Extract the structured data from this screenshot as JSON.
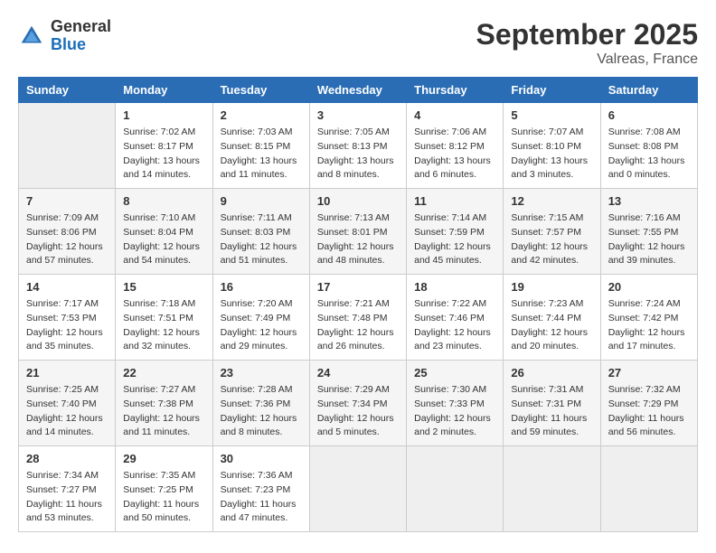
{
  "header": {
    "logo_general": "General",
    "logo_blue": "Blue",
    "month": "September 2025",
    "location": "Valreas, France"
  },
  "days_of_week": [
    "Sunday",
    "Monday",
    "Tuesday",
    "Wednesday",
    "Thursday",
    "Friday",
    "Saturday"
  ],
  "weeks": [
    [
      {
        "day": "",
        "sunrise": "",
        "sunset": "",
        "daylight": "",
        "empty": true
      },
      {
        "day": "1",
        "sunrise": "Sunrise: 7:02 AM",
        "sunset": "Sunset: 8:17 PM",
        "daylight": "Daylight: 13 hours and 14 minutes."
      },
      {
        "day": "2",
        "sunrise": "Sunrise: 7:03 AM",
        "sunset": "Sunset: 8:15 PM",
        "daylight": "Daylight: 13 hours and 11 minutes."
      },
      {
        "day": "3",
        "sunrise": "Sunrise: 7:05 AM",
        "sunset": "Sunset: 8:13 PM",
        "daylight": "Daylight: 13 hours and 8 minutes."
      },
      {
        "day": "4",
        "sunrise": "Sunrise: 7:06 AM",
        "sunset": "Sunset: 8:12 PM",
        "daylight": "Daylight: 13 hours and 6 minutes."
      },
      {
        "day": "5",
        "sunrise": "Sunrise: 7:07 AM",
        "sunset": "Sunset: 8:10 PM",
        "daylight": "Daylight: 13 hours and 3 minutes."
      },
      {
        "day": "6",
        "sunrise": "Sunrise: 7:08 AM",
        "sunset": "Sunset: 8:08 PM",
        "daylight": "Daylight: 13 hours and 0 minutes."
      }
    ],
    [
      {
        "day": "7",
        "sunrise": "Sunrise: 7:09 AM",
        "sunset": "Sunset: 8:06 PM",
        "daylight": "Daylight: 12 hours and 57 minutes."
      },
      {
        "day": "8",
        "sunrise": "Sunrise: 7:10 AM",
        "sunset": "Sunset: 8:04 PM",
        "daylight": "Daylight: 12 hours and 54 minutes."
      },
      {
        "day": "9",
        "sunrise": "Sunrise: 7:11 AM",
        "sunset": "Sunset: 8:03 PM",
        "daylight": "Daylight: 12 hours and 51 minutes."
      },
      {
        "day": "10",
        "sunrise": "Sunrise: 7:13 AM",
        "sunset": "Sunset: 8:01 PM",
        "daylight": "Daylight: 12 hours and 48 minutes."
      },
      {
        "day": "11",
        "sunrise": "Sunrise: 7:14 AM",
        "sunset": "Sunset: 7:59 PM",
        "daylight": "Daylight: 12 hours and 45 minutes."
      },
      {
        "day": "12",
        "sunrise": "Sunrise: 7:15 AM",
        "sunset": "Sunset: 7:57 PM",
        "daylight": "Daylight: 12 hours and 42 minutes."
      },
      {
        "day": "13",
        "sunrise": "Sunrise: 7:16 AM",
        "sunset": "Sunset: 7:55 PM",
        "daylight": "Daylight: 12 hours and 39 minutes."
      }
    ],
    [
      {
        "day": "14",
        "sunrise": "Sunrise: 7:17 AM",
        "sunset": "Sunset: 7:53 PM",
        "daylight": "Daylight: 12 hours and 35 minutes."
      },
      {
        "day": "15",
        "sunrise": "Sunrise: 7:18 AM",
        "sunset": "Sunset: 7:51 PM",
        "daylight": "Daylight: 12 hours and 32 minutes."
      },
      {
        "day": "16",
        "sunrise": "Sunrise: 7:20 AM",
        "sunset": "Sunset: 7:49 PM",
        "daylight": "Daylight: 12 hours and 29 minutes."
      },
      {
        "day": "17",
        "sunrise": "Sunrise: 7:21 AM",
        "sunset": "Sunset: 7:48 PM",
        "daylight": "Daylight: 12 hours and 26 minutes."
      },
      {
        "day": "18",
        "sunrise": "Sunrise: 7:22 AM",
        "sunset": "Sunset: 7:46 PM",
        "daylight": "Daylight: 12 hours and 23 minutes."
      },
      {
        "day": "19",
        "sunrise": "Sunrise: 7:23 AM",
        "sunset": "Sunset: 7:44 PM",
        "daylight": "Daylight: 12 hours and 20 minutes."
      },
      {
        "day": "20",
        "sunrise": "Sunrise: 7:24 AM",
        "sunset": "Sunset: 7:42 PM",
        "daylight": "Daylight: 12 hours and 17 minutes."
      }
    ],
    [
      {
        "day": "21",
        "sunrise": "Sunrise: 7:25 AM",
        "sunset": "Sunset: 7:40 PM",
        "daylight": "Daylight: 12 hours and 14 minutes."
      },
      {
        "day": "22",
        "sunrise": "Sunrise: 7:27 AM",
        "sunset": "Sunset: 7:38 PM",
        "daylight": "Daylight: 12 hours and 11 minutes."
      },
      {
        "day": "23",
        "sunrise": "Sunrise: 7:28 AM",
        "sunset": "Sunset: 7:36 PM",
        "daylight": "Daylight: 12 hours and 8 minutes."
      },
      {
        "day": "24",
        "sunrise": "Sunrise: 7:29 AM",
        "sunset": "Sunset: 7:34 PM",
        "daylight": "Daylight: 12 hours and 5 minutes."
      },
      {
        "day": "25",
        "sunrise": "Sunrise: 7:30 AM",
        "sunset": "Sunset: 7:33 PM",
        "daylight": "Daylight: 12 hours and 2 minutes."
      },
      {
        "day": "26",
        "sunrise": "Sunrise: 7:31 AM",
        "sunset": "Sunset: 7:31 PM",
        "daylight": "Daylight: 11 hours and 59 minutes."
      },
      {
        "day": "27",
        "sunrise": "Sunrise: 7:32 AM",
        "sunset": "Sunset: 7:29 PM",
        "daylight": "Daylight: 11 hours and 56 minutes."
      }
    ],
    [
      {
        "day": "28",
        "sunrise": "Sunrise: 7:34 AM",
        "sunset": "Sunset: 7:27 PM",
        "daylight": "Daylight: 11 hours and 53 minutes."
      },
      {
        "day": "29",
        "sunrise": "Sunrise: 7:35 AM",
        "sunset": "Sunset: 7:25 PM",
        "daylight": "Daylight: 11 hours and 50 minutes."
      },
      {
        "day": "30",
        "sunrise": "Sunrise: 7:36 AM",
        "sunset": "Sunset: 7:23 PM",
        "daylight": "Daylight: 11 hours and 47 minutes."
      },
      {
        "day": "",
        "sunrise": "",
        "sunset": "",
        "daylight": "",
        "empty": true
      },
      {
        "day": "",
        "sunrise": "",
        "sunset": "",
        "daylight": "",
        "empty": true
      },
      {
        "day": "",
        "sunrise": "",
        "sunset": "",
        "daylight": "",
        "empty": true
      },
      {
        "day": "",
        "sunrise": "",
        "sunset": "",
        "daylight": "",
        "empty": true
      }
    ]
  ]
}
